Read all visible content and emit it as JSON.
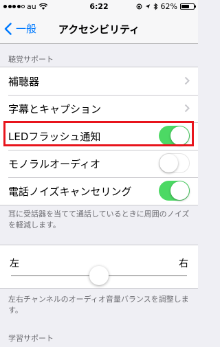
{
  "status_bar": {
    "carrier": "au",
    "time": "6:22",
    "battery_text": "62%",
    "battery_level": 0.62,
    "signal_filled": 4,
    "signal_total": 5
  },
  "nav": {
    "back_label": "一般",
    "title": "アクセシビリティ"
  },
  "hearing": {
    "header": "聴覚サポート",
    "items": [
      {
        "label": "補聴器",
        "accessory": "chevron"
      },
      {
        "label": "字幕とキャプション",
        "accessory": "chevron"
      },
      {
        "label": "LEDフラッシュ通知",
        "accessory": "toggle",
        "on": true
      },
      {
        "label": "モノラルオーディオ",
        "accessory": "toggle",
        "on": false
      },
      {
        "label": "電話ノイズキャンセリング",
        "accessory": "toggle",
        "on": true
      }
    ],
    "footer": "耳に受話器を当てて通話しているときに周囲のノイズを軽減します。"
  },
  "balance": {
    "left_label": "左",
    "right_label": "右",
    "value": 0.5,
    "footer": "左右チャンネルのオーディオ音量バランスを調整します。"
  },
  "learning": {
    "header": "学習サポート"
  },
  "colors": {
    "accent": "#007aff",
    "toggle_on": "#4cd964",
    "highlight": "#e8141c",
    "background": "#efeff4"
  }
}
